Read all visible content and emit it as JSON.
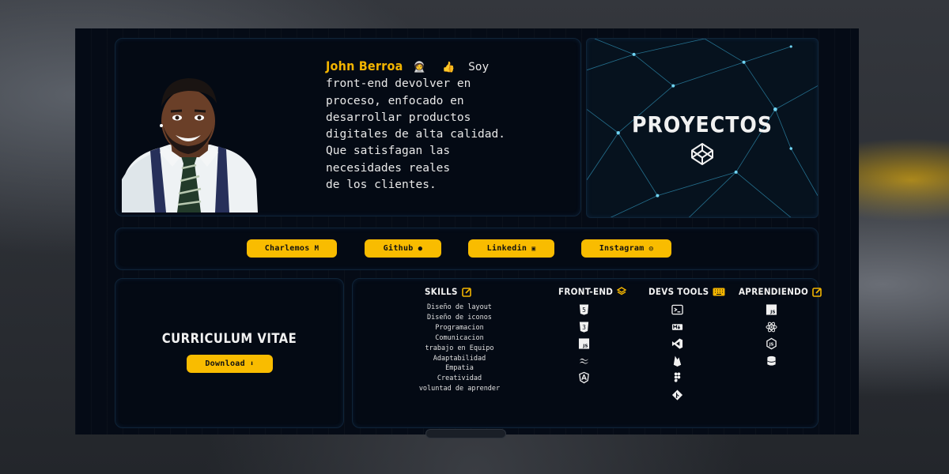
{
  "profile": {
    "name": "John Berroa",
    "bio_lines": [
      "Soy",
      "front-end devolver en",
      "proceso, enfocado en",
      "desarrollar productos",
      "digitales de alta calidad.",
      "Que satisfagan las",
      "necesidades reales",
      "de los clientes."
    ]
  },
  "projects": {
    "title": "PROYECTOS"
  },
  "socials": [
    {
      "label": "Charlemos",
      "icon": "gmail-icon"
    },
    {
      "label": "Github",
      "icon": "github-icon"
    },
    {
      "label": "Linkedin",
      "icon": "linkedin-icon"
    },
    {
      "label": "Instagram",
      "icon": "instagram-icon"
    }
  ],
  "cv": {
    "title": "CURRICULUM VITAE",
    "download_label": "Download"
  },
  "skills": {
    "title": "SKILLS",
    "items": [
      "Diseño de layout",
      "Diseño de iconos",
      "Programacion",
      "Comunicacion",
      "trabajo en Equipo",
      "Adaptabilidad",
      "Empatia",
      "Creatividad",
      "voluntad de aprender"
    ]
  },
  "frontend": {
    "title": "FRONT-END",
    "icons": [
      "html5-icon",
      "css3-icon",
      "javascript-icon",
      "tailwind-icon",
      "angular-icon"
    ]
  },
  "devtools": {
    "title": "DEVS TOOLS",
    "icons": [
      "terminal-icon",
      "markdown-icon",
      "vscode-icon",
      "firebase-icon",
      "figma-icon",
      "git-icon"
    ]
  },
  "learning": {
    "title": "APRENDIENDO",
    "icons": [
      "javascript-icon",
      "react-icon",
      "nodejs-icon",
      "database-icon"
    ]
  },
  "colors": {
    "accent": "#f9bc00",
    "background": "#050b16",
    "name": "#f2b400"
  }
}
